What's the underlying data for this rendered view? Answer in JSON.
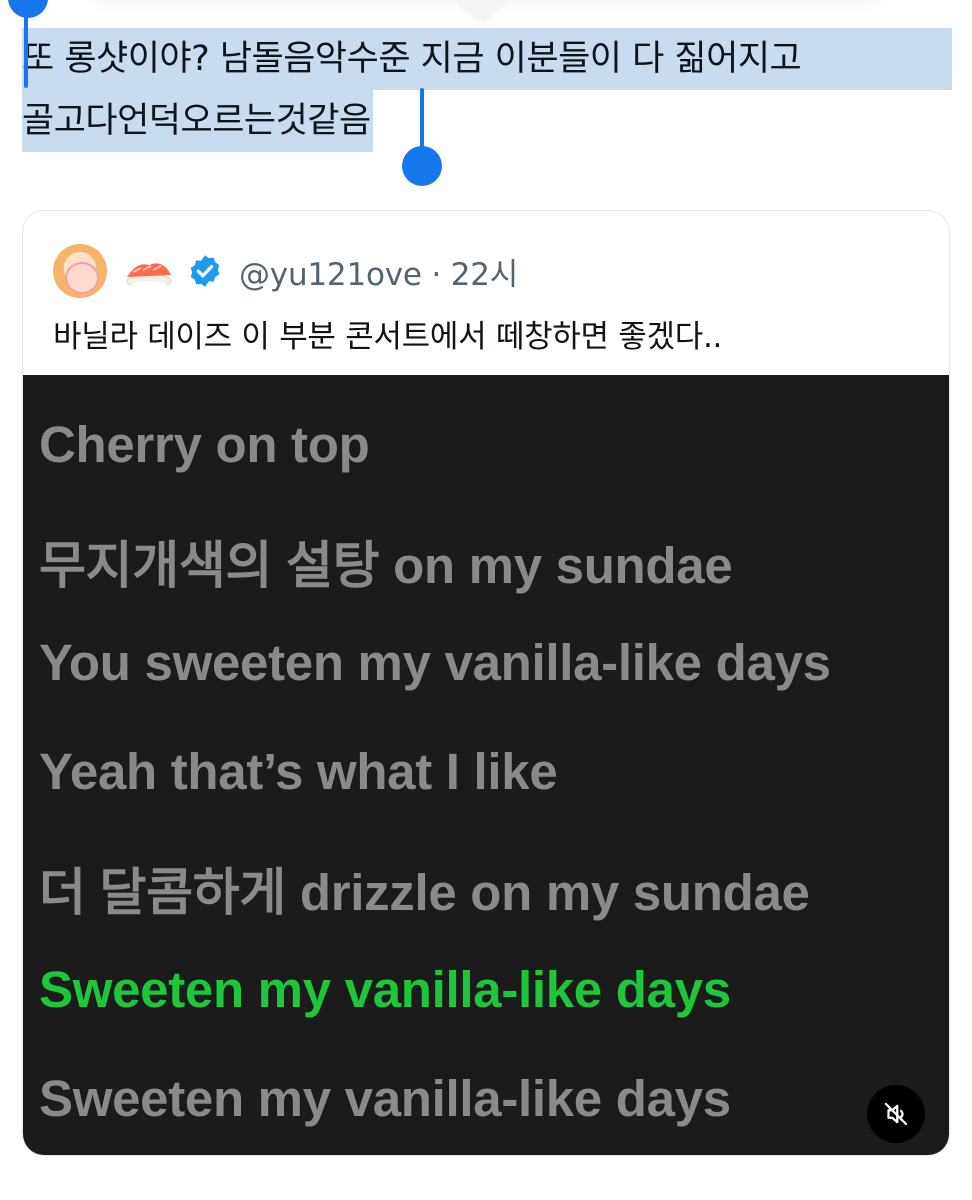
{
  "tweet": {
    "text_line1": "또 롱샷이야? 남돌음악수준 지금 이분들이 다 짊어지고",
    "text_line2": "골고다언덕오르는것같음"
  },
  "quoted_tweet": {
    "handle_time": "@yu121ove · 22시",
    "text": "바닐라 데이즈 이 부분 콘서트에서 떼창하면 좋겠다..",
    "avatar_icon": "profile-avatar",
    "emoji_icon": "sushi-icon",
    "badge_icon": "verified-badge-icon"
  },
  "media": {
    "lyrics": [
      "Cherry on top",
      "무지개색의 설탕 on my sundae",
      "You sweeten my vanilla-like days",
      "Yeah that’s what I like",
      "더 달콤하게 drizzle on my sundae",
      "Sweeten my vanilla-like days",
      "Sweeten my vanilla-like days"
    ],
    "active_index": 5,
    "mute_icon": "sound-off-icon"
  },
  "colors": {
    "selection": "#c9dcef",
    "handle": "#1677ed",
    "lyric_active": "#1ec63c",
    "lyric_inactive": "#8a8a8a",
    "media_bg": "#1b1b1b",
    "verified": "#1d9bf0"
  }
}
